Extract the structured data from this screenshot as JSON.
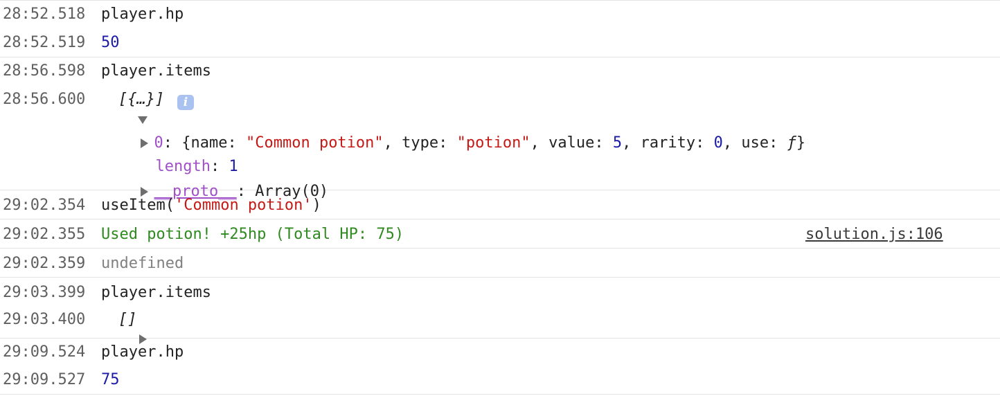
{
  "console": {
    "entries": [
      {
        "time": "28:52.518",
        "text": "player.hp"
      },
      {
        "time": "28:52.519",
        "text": "50"
      },
      {
        "time": "28:56.598",
        "text": "player.items"
      },
      {
        "time": "28:56.600",
        "text": "[{…}]"
      },
      {
        "time": "29:02.354",
        "text": "useItem('Common potion')"
      },
      {
        "time": "29:02.355",
        "text": "Used potion! +25hp (Total HP: 75)",
        "source": "solution.js:106"
      },
      {
        "time": "29:02.359",
        "text": "undefined"
      },
      {
        "time": "29:03.399",
        "text": "player.items"
      },
      {
        "time": "29:03.400",
        "text": "[]"
      },
      {
        "time": "29:09.524",
        "text": "player.hp"
      },
      {
        "time": "29:09.527",
        "text": "75"
      }
    ],
    "expanded_array": {
      "info_icon": "i",
      "item0": {
        "index": "0",
        "name_key": "name",
        "name_val": "\"Common potion\"",
        "type_key": "type",
        "type_val": "\"potion\"",
        "value_key": "value",
        "value_val": "5",
        "rarity_key": "rarity",
        "rarity_val": "0",
        "use_key": "use",
        "use_val": "ƒ"
      },
      "length_key": "length",
      "length_val": "1",
      "proto_key": "__proto__",
      "proto_val": "Array(0)"
    },
    "useItem_call": {
      "fn": "useItem(",
      "arg": "'Common potion'",
      "close": ")"
    }
  }
}
